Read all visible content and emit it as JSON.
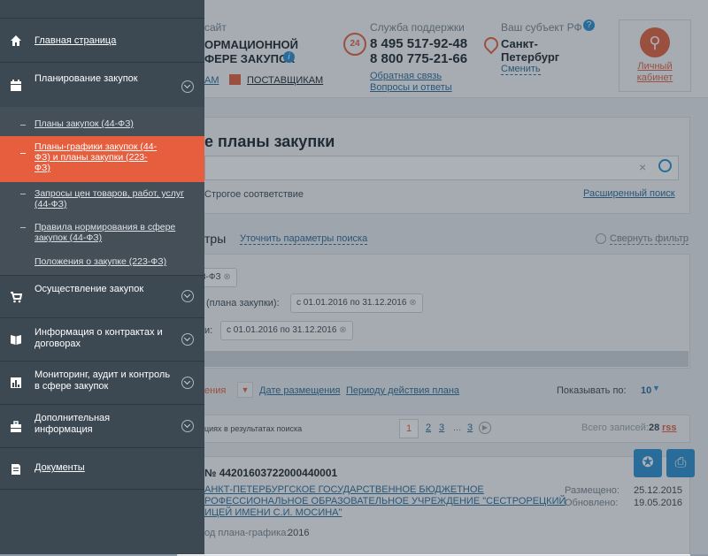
{
  "header": {
    "site_label": "сайт",
    "site_line1": "ОРМАЦИОННОЙ",
    "site_line2": "ФЕРЕ ЗАКУПОК",
    "link_left": "АМ",
    "suppliers_link": "ПОСТАВЩИКАМ",
    "support_label": "Служба поддержки",
    "phone1": "8 495 517-92-48",
    "phone2": "8 800 775-21-66",
    "feedback_link": "Обратная связь",
    "faq_link": "Вопросы и ответы",
    "region_label": "Ваш субъект РФ",
    "region_line1": "Санкт-",
    "region_line2": "Петербург",
    "region_change": "Сменить",
    "cabinet_line1": "Личный",
    "cabinet_line2": "кабинет",
    "badge_24": "24"
  },
  "search": {
    "title": "е планы закупки",
    "exact_match": "Строгое соответствие",
    "advanced": "Расширенный поиск",
    "filters_label": "тры",
    "refine_link": "Уточнить параметры поиска",
    "collapse_filter": "Свернуть фильтр",
    "tag1": "3-ФЗ",
    "tag2_label": "(плана закупки):",
    "tag2_value": "с 01.01.2016 по 31.12.2016",
    "tag3_label": "и:",
    "tag3_value": "с 01.01.2016 по 31.12.2016"
  },
  "sorting": {
    "active_sort": "ения",
    "sort_date": "Дате размещения",
    "sort_period": "Периоду действия плана",
    "show_by_label": "Показывать по:",
    "show_by_value": "10"
  },
  "results": {
    "summary": "циях в результатах поиска",
    "pages": [
      "1",
      "2",
      "3",
      "...",
      "3"
    ],
    "total_label": "Всего записей:",
    "total_value": "28",
    "rss": "rss"
  },
  "record": {
    "number": "№ 44201603722000440001",
    "org_line1": "АНКТ-ПЕТЕРБУРГСКОЕ ГОСУДАРСТВЕННОЕ БЮДЖЕТНОЕ",
    "org_line2": "РОФЕССИОНАЛЬНОЕ ОБРАЗОВАТЕЛЬНОЕ УЧРЕЖДЕНИЕ \"СЕСТРОРЕЦКИЙ",
    "org_line3": "ИЦЕЙ ИМЕНИ С.И. МОСИНА\"",
    "year_label": "од плана-графика:",
    "year_value": "2016",
    "posted_label": "Размещено:",
    "posted_value": "25.12.2015",
    "updated_label": "Обновлено:",
    "updated_value": "19.05.2016"
  },
  "menu": {
    "items": [
      {
        "label": "Главная страница",
        "icon": "home-icon"
      },
      {
        "label": "Планирование закупок",
        "icon": "calendar-icon"
      },
      {
        "label": "Осуществление закупок",
        "icon": "cart-icon"
      },
      {
        "label": "Информация о контрактах и договорах",
        "icon": "book-icon"
      },
      {
        "label": "Мониторинг, аудит и контроль в сфере закупок",
        "icon": "chart-icon"
      },
      {
        "label": "Дополнительная информация",
        "icon": "briefcase-icon"
      },
      {
        "label": "Документы",
        "icon": "document-icon"
      }
    ],
    "subitems": [
      {
        "label": "Планы закупок (44-ФЗ)"
      },
      {
        "label": "Планы-графики закупок (44-ФЗ) и планы закупки (223-ФЗ)"
      },
      {
        "label": "Запросы цен товаров, работ, услуг (44-ФЗ)"
      },
      {
        "label": "Правила нормирования в сфере закупок (44-ФЗ)"
      },
      {
        "label": "Положения о закупке (223-ФЗ)"
      }
    ]
  },
  "colors": {
    "accent": "#e65e3d",
    "menu_bg": "#3c4852",
    "link": "#2d6d99"
  }
}
